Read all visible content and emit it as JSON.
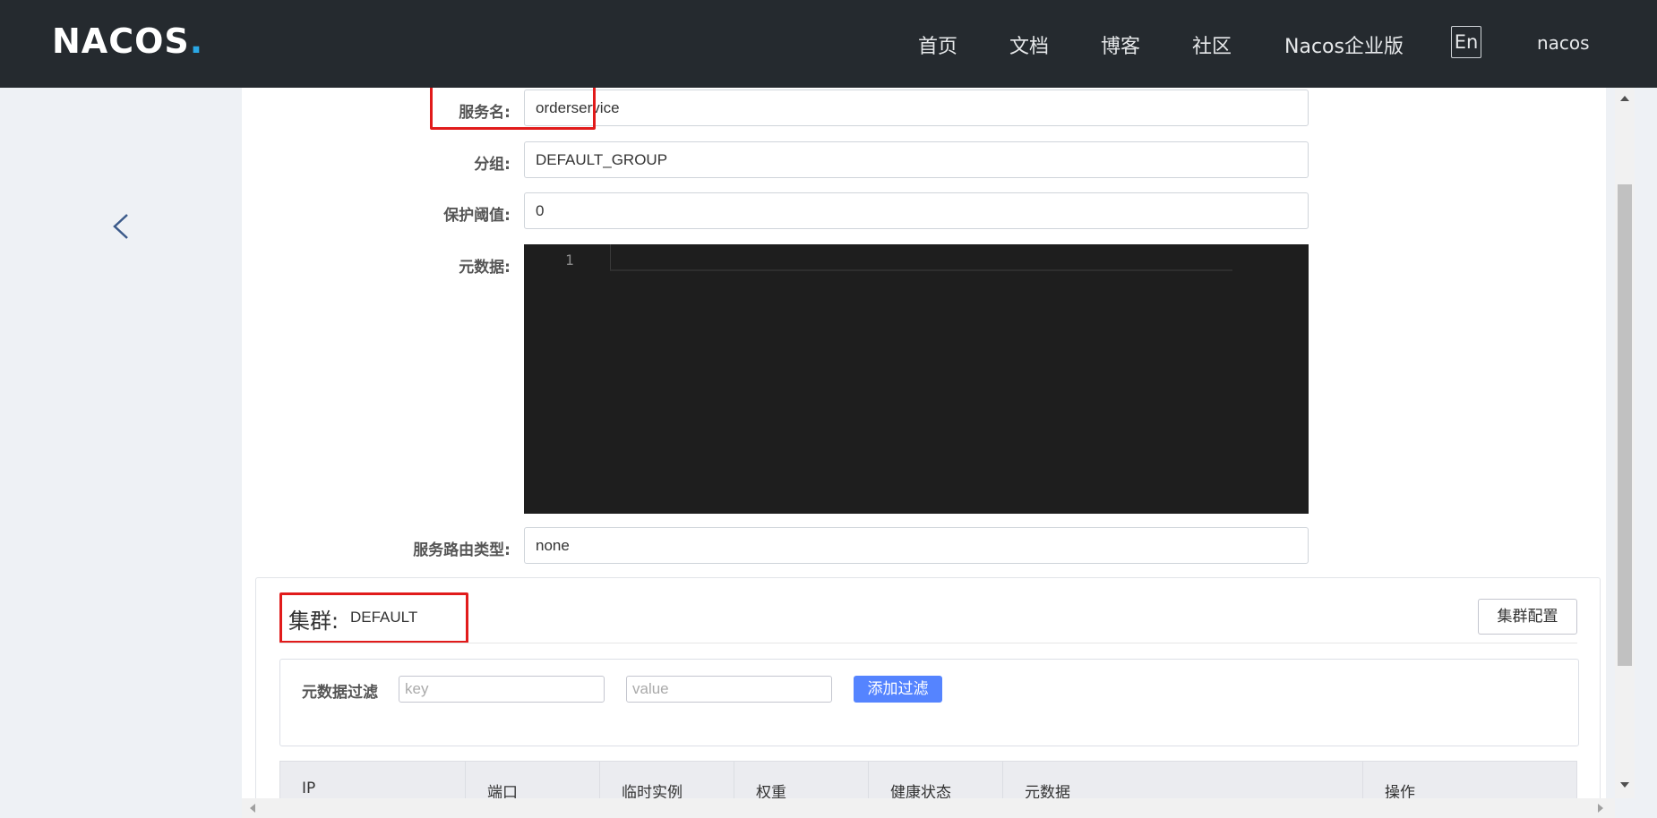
{
  "nav": {
    "logo_main": "NACOS",
    "logo_dot": ".",
    "links": [
      "首页",
      "文档",
      "博客",
      "社区",
      "Nacos企业版"
    ],
    "lang": "En",
    "user": "nacos"
  },
  "form": {
    "service_name_label": "服务名:",
    "service_name_value": "orderservice",
    "group_label": "分组:",
    "group_value": "DEFAULT_GROUP",
    "threshold_label": "保护阈值:",
    "threshold_value": "0",
    "metadata_label": "元数据:",
    "metadata_line_number": "1",
    "route_type_label": "服务路由类型:",
    "route_type_value": "none"
  },
  "cluster": {
    "title": "集群:",
    "name": "DEFAULT",
    "config_button": "集群配置",
    "filter_label": "元数据过滤",
    "key_placeholder": "key",
    "value_placeholder": "value",
    "add_filter_button": "添加过滤",
    "columns": [
      "IP",
      "端口",
      "临时实例",
      "权重",
      "健康状态",
      "元数据",
      "操作"
    ]
  },
  "colors": {
    "topbar": "#252a2f",
    "highlight": "#e11b1b",
    "primary": "#5584ff"
  },
  "icons": {
    "back": "chevron-left-icon"
  }
}
